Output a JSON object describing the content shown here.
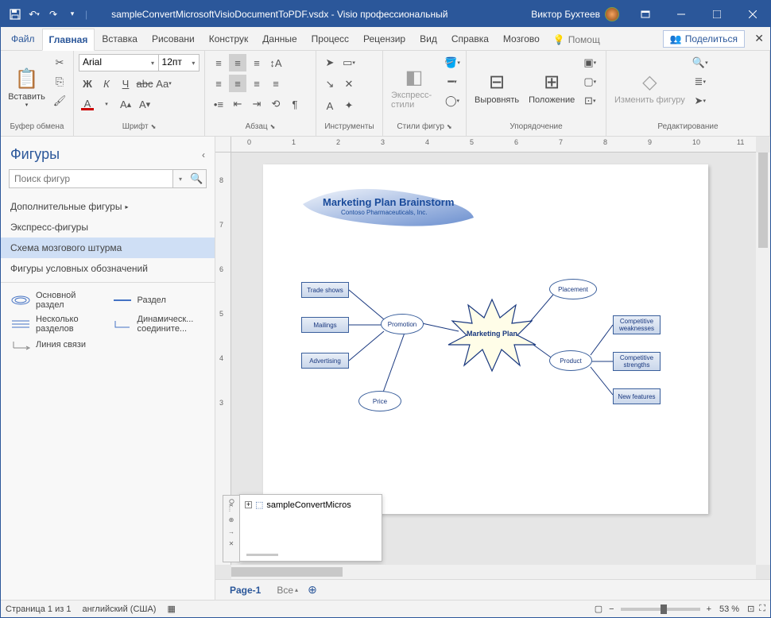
{
  "title": "sampleConvertMicrosoftVisioDocumentToPDF.vsdx  -  Visio профессиональный",
  "user": "Виктор Бухтеев",
  "tabs": [
    "Файл",
    "Главная",
    "Вставка",
    "Рисовани",
    "Конструк",
    "Данные",
    "Процесс",
    "Рецензир",
    "Вид",
    "Справка",
    "Мозгово"
  ],
  "activeTab": 1,
  "tellme": "Помощ",
  "share": "Поделиться",
  "groups": {
    "clipboard": {
      "label": "Буфер обмена",
      "paste": "Вставить"
    },
    "font": {
      "label": "Шрифт",
      "name": "Arial",
      "size": "12пт"
    },
    "para": {
      "label": "Абзац"
    },
    "tools": {
      "label": "Инструменты"
    },
    "styles": {
      "label": "Стили фигур",
      "express": "Экспресс-стили"
    },
    "arrange": {
      "label": "Упорядочение",
      "align": "Выровнять",
      "position": "Положение"
    },
    "edit": {
      "label": "Редактирование",
      "changeShape": "Изменить фигуру"
    }
  },
  "shapes": {
    "title": "Фигуры",
    "search": "Поиск фигур",
    "cats": [
      "Дополнительные фигуры",
      "Экспресс-фигуры",
      "Схема мозгового штурма",
      "Фигуры условных обозначений"
    ],
    "activeCat": 2,
    "stencil": [
      {
        "label": "Основной раздел"
      },
      {
        "label": "Раздел"
      },
      {
        "label": "Несколько разделов"
      },
      {
        "label": "Динамическ... соедините..."
      },
      {
        "label": "Линия связи"
      }
    ]
  },
  "diagram": {
    "title": "Marketing Plan Brainstorm",
    "subtitle": "Contoso Pharmaceuticals, Inc.",
    "center": "Marketing Plan",
    "nodes": {
      "promotion": "Promotion",
      "price": "Price",
      "product": "Product",
      "placement": "Placement",
      "trade": "Trade shows",
      "mailings": "Mailings",
      "advertising": "Advertising",
      "compweak": "Competitive weaknesses",
      "compstr": "Competitive strengths",
      "newfeat": "New features"
    }
  },
  "miniwin": "sampleConvertMicros",
  "pagetabs": {
    "page": "Page-1",
    "all": "Все"
  },
  "status": {
    "page": "Страница 1 из 1",
    "lang": "английский (США)",
    "zoom": "53 %"
  },
  "rulerH": [
    "0",
    "1",
    "2",
    "3",
    "4",
    "5",
    "6",
    "7",
    "8",
    "9",
    "10",
    "11"
  ],
  "rulerV": [
    "8",
    "7",
    "6",
    "5",
    "4",
    "3"
  ]
}
